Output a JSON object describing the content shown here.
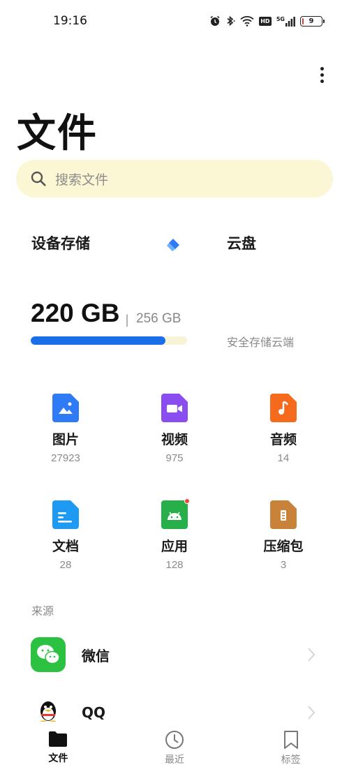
{
  "status_bar": {
    "time": "19:16",
    "battery_level": "9",
    "network": "5G",
    "hd_label": "HD"
  },
  "header": {
    "title": "文件"
  },
  "search": {
    "placeholder": "搜索文件"
  },
  "storage": {
    "device_label": "设备存储",
    "cloud_label": "云盘",
    "used": "220 GB",
    "separator": "|",
    "total": "256 GB",
    "used_fraction": 0.86,
    "cloud_subtitle": "安全存储云端",
    "bar_color": "#1a6fe8"
  },
  "categories": [
    {
      "name": "图片",
      "count": "27923",
      "icon": "image-icon",
      "color": "#2f7bf5"
    },
    {
      "name": "视频",
      "count": "975",
      "icon": "video-icon",
      "color": "#8a4df0"
    },
    {
      "name": "音频",
      "count": "14",
      "icon": "music-icon",
      "color": "#f56a1d"
    },
    {
      "name": "文档",
      "count": "28",
      "icon": "document-icon",
      "color": "#1f9af2"
    },
    {
      "name": "应用",
      "count": "128",
      "icon": "android-icon",
      "color": "#27b04a"
    },
    {
      "name": "压缩包",
      "count": "3",
      "icon": "archive-icon",
      "color": "#c8823a"
    }
  ],
  "sources": {
    "label": "来源",
    "items": [
      {
        "name": "微信",
        "icon": "wechat-icon",
        "color": "#2dc142"
      },
      {
        "name": "QQ",
        "icon": "qq-icon",
        "color": "#ffffff"
      }
    ]
  },
  "nav": [
    {
      "label": "文件",
      "icon": "folder-icon",
      "active": true
    },
    {
      "label": "最近",
      "icon": "clock-icon",
      "active": false
    },
    {
      "label": "标签",
      "icon": "bookmark-icon",
      "active": false
    }
  ]
}
